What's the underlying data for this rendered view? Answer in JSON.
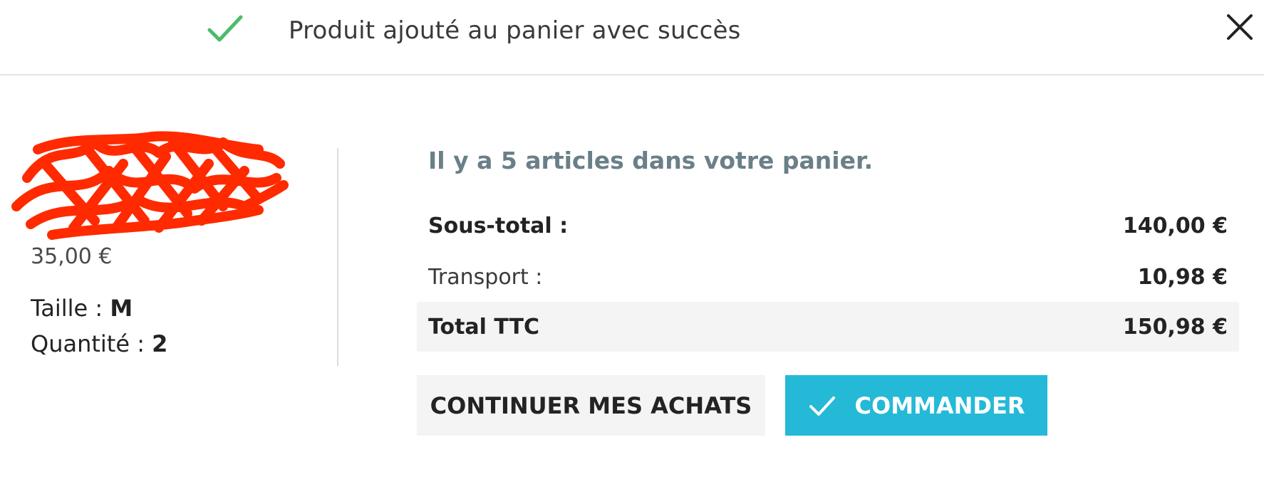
{
  "header": {
    "title": "Produit ajouté au panier avec succès",
    "success_icon": "checkmark-icon",
    "close_icon": "close-icon",
    "success_color": "#4cbb6c"
  },
  "product": {
    "name": "",
    "price": "35,00 €",
    "size_label": "Taille :",
    "size_value": "M",
    "quantity_label": "Quantité :",
    "quantity_value": "2",
    "name_color": "#24b9d7",
    "redaction_color": "#ff2a00"
  },
  "cart": {
    "count_text": "Il y a 5 articles dans votre panier.",
    "subtotal_label": "Sous-total :",
    "subtotal_value": "140,00 €",
    "shipping_label": "Transport :",
    "shipping_value": "10,98 €",
    "total_label": "Total TTC",
    "total_value": "150,98 €"
  },
  "actions": {
    "continue_label": "CONTINUER MES ACHATS",
    "order_label": "COMMANDER",
    "order_icon": "checkmark-icon",
    "accent_color": "#24b9d7"
  }
}
